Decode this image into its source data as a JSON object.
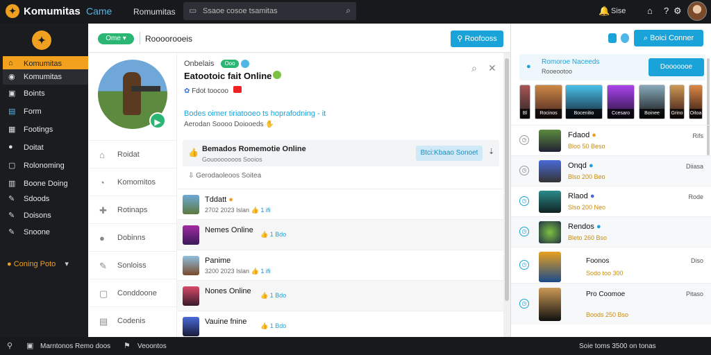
{
  "topbar": {
    "brand": "Komumitas",
    "brand_secondary": "Came",
    "nav_link": "Romumitas",
    "search_placeholder": "Ssaoe cosoe tsamitas",
    "user_label": "Sise"
  },
  "sidebar": {
    "items": [
      {
        "label": "Komumitas",
        "icon": "home-icon"
      },
      {
        "label": "Komumitas",
        "icon": "community-icon"
      },
      {
        "label": "Boints",
        "icon": "points-icon"
      },
      {
        "label": "Form",
        "icon": "forum-icon"
      },
      {
        "label": "Footings",
        "icon": "feed-icon"
      },
      {
        "label": "Doitat",
        "icon": "chat-icon"
      },
      {
        "label": "Rolonoming",
        "icon": "ranking-icon"
      },
      {
        "label": "Boone Doing",
        "icon": "activity-icon"
      },
      {
        "label": "Sdoods",
        "icon": "tools-icon"
      },
      {
        "label": "Doisons",
        "icon": "tools-icon"
      },
      {
        "label": "Snoone",
        "icon": "tools-icon"
      }
    ],
    "game_label": "Coning Poto"
  },
  "panel": {
    "header": {
      "online_badge": "Ome",
      "title": "Roooorooeis",
      "button": "Roofooss"
    },
    "left_nav": [
      {
        "label": "Roidat",
        "icon": "document-icon"
      },
      {
        "label": "Komomitos",
        "icon": "community-icon"
      },
      {
        "label": "Rotinaps",
        "icon": "tag-icon"
      },
      {
        "label": "Dobinns",
        "icon": "info-icon"
      },
      {
        "label": "Sonloiss",
        "icon": "tools-icon"
      },
      {
        "label": "Conddoone",
        "icon": "calendar-icon"
      },
      {
        "label": "Codenis",
        "icon": "list-icon"
      }
    ],
    "game": {
      "tag_label": "Onbelais",
      "tag_pill": "Ooo",
      "name": "Eatootoic fait Online",
      "meta": "Fdot toocoo",
      "status": "Bodes oimer tiriatooeo ts hoprafodning - it",
      "author": "Aerodan Soooo Doiooeds"
    },
    "event": {
      "title": "Bemados Romemotie Online",
      "subtitle": "Gouooooooos Sooios",
      "button": "Btci:Kbaao Sonoet"
    },
    "download_line": "Gerodaoleoos Soitea",
    "feed": [
      {
        "name": "Tddatt",
        "meta": "2702 2023 Islan",
        "stat": "1 ifi"
      },
      {
        "name": "Nemes Online",
        "meta": "",
        "stat": "1 Bdo"
      },
      {
        "name": "Panime",
        "meta": "3200 2023 Islan",
        "stat": "1 ifi"
      },
      {
        "name": "Nones Online",
        "meta": "",
        "stat": "1 Bdo"
      },
      {
        "name": "Vauine fnine",
        "meta": "",
        "stat": "1 Bdo"
      }
    ]
  },
  "right_panel": {
    "button": "Boici Conner",
    "box": {
      "title": "Romoroe Naceeds",
      "subtitle": "Rooeootoo",
      "button": "Dooooooe"
    },
    "tiles": [
      "Bl",
      "Rocinos",
      "Bocenitio",
      "Ccesaro",
      "Boinee",
      "Grino",
      "Oitoa"
    ],
    "list": [
      {
        "name": "Fdaod",
        "meta": "Bloo 50 Beso",
        "right": "Rifs"
      },
      {
        "name": "Onqd",
        "meta": "Blso 200 Beo",
        "right": "Diiasa"
      },
      {
        "name": "Rlaod",
        "meta": "Slso 200 Neo",
        "right": "Rode"
      },
      {
        "name": "Rendos",
        "meta": "Bleto 260 Bso",
        "right": ""
      },
      {
        "name": "Foonos",
        "meta": "Sodo too 300",
        "right": "Diso"
      },
      {
        "name": "Pro Coomoe",
        "meta": "Boods 250 Bso",
        "right": "Pitaso"
      }
    ]
  },
  "bottombar": {
    "left_text": "Marntonos Remo doos",
    "mid_text": "Veoontos",
    "right_text": "Soie toms 3500 on tonas"
  }
}
